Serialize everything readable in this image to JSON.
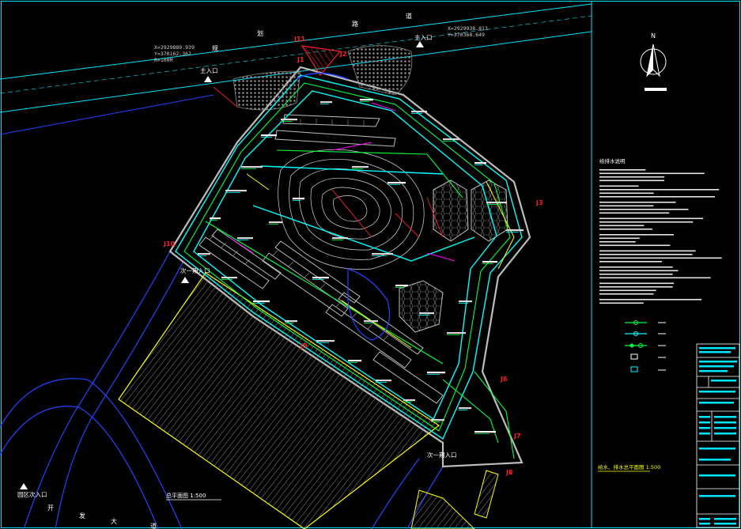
{
  "colors": {
    "background": "#000000",
    "frame": "#00e5ff",
    "boundary": "#ffff00",
    "road": "#2244ff",
    "pipe_green": "#00ff3c",
    "pipe_cyan": "#00ffff",
    "magenta": "#ff00ff",
    "red": "#ff2020",
    "white": "#ffffff",
    "gray": "#9a9a9a"
  },
  "labels": {
    "main_entrance_top": "主入口",
    "main_entrance_left": "主入口",
    "secondary_entrance_left": "次一期入口",
    "secondary_entrance_bottom": "次一期入口",
    "bottom_left_entrance": "园区次入口",
    "scale_note": "总平面图 1:500",
    "coord_left_x": "X=2929889.939",
    "coord_left_y": "Y=370162.362",
    "coord_left_r": "R=100M",
    "coord_right_x": "X=2929938.813",
    "coord_right_y": "Y=370368.649",
    "north": "N",
    "plan_title": "给水、排水总平面图 1:500",
    "notes_title": "给排水说明"
  },
  "node_labels": {
    "j1": "J1",
    "j2": "J2",
    "j3": "J3",
    "j6": "J6",
    "j7": "J7",
    "j8": "J8",
    "j9": "J9",
    "j10": "J10",
    "j11": "J11"
  },
  "road_chars": {
    "top": [
      "规",
      "划",
      "路",
      "道"
    ],
    "bottom": [
      "开",
      "发",
      "大",
      "道"
    ]
  }
}
